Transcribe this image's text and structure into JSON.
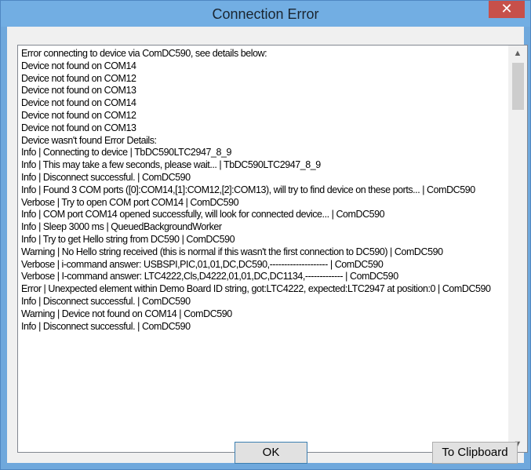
{
  "window": {
    "title": "Connection Error",
    "close_glyph": "✕"
  },
  "log_lines": [
    "Error connecting to device via ComDC590, see details below:",
    "Device not found on COM14",
    "Device not found on COM12",
    "Device not found on COM13",
    "Device not found on COM14",
    "Device not found on COM12",
    "Device not found on COM13",
    "Device wasn't found Error Details:",
    "Info | Connecting to device | TbDC590LTC2947_8_9",
    "Info | This may take a few seconds, please wait... | TbDC590LTC2947_8_9",
    "Info | Disconnect successful. | ComDC590",
    "Info | Found 3 COM ports ([0]:COM14,[1]:COM12,[2]:COM13), will try to find device on these ports... | ComDC590",
    "Verbose | Try to open COM port COM14 | ComDC590",
    "Info | COM port COM14 opened successfully, will look for connected device... | ComDC590",
    "Info | Sleep 3000 ms | QueuedBackgroundWorker",
    "Info | Try to get Hello string from DC590 | ComDC590",
    "Warning | No Hello string received (this is normal if this wasn't the first connection to DC590) | ComDC590",
    "Verbose | i-command answer: USBSPI,PIC,01,01,DC,DC590,-------------------- | ComDC590",
    "Verbose | I-command answer: LTC4222,Cls,D4222,01,01,DC,DC1134,------------- | ComDC590",
    "Error | Unexpected element within Demo Board ID string, got:LTC4222, expected:LTC2947 at position:0 | ComDC590",
    "Info | Disconnect successful. | ComDC590",
    "Warning | Device not found on COM14 | ComDC590",
    "Info | Disconnect successful. | ComDC590"
  ],
  "scrollbar": {
    "up_glyph": "▲",
    "down_glyph": "▼"
  },
  "buttons": {
    "ok_label": "OK",
    "clipboard_label": "To Clipboard"
  }
}
